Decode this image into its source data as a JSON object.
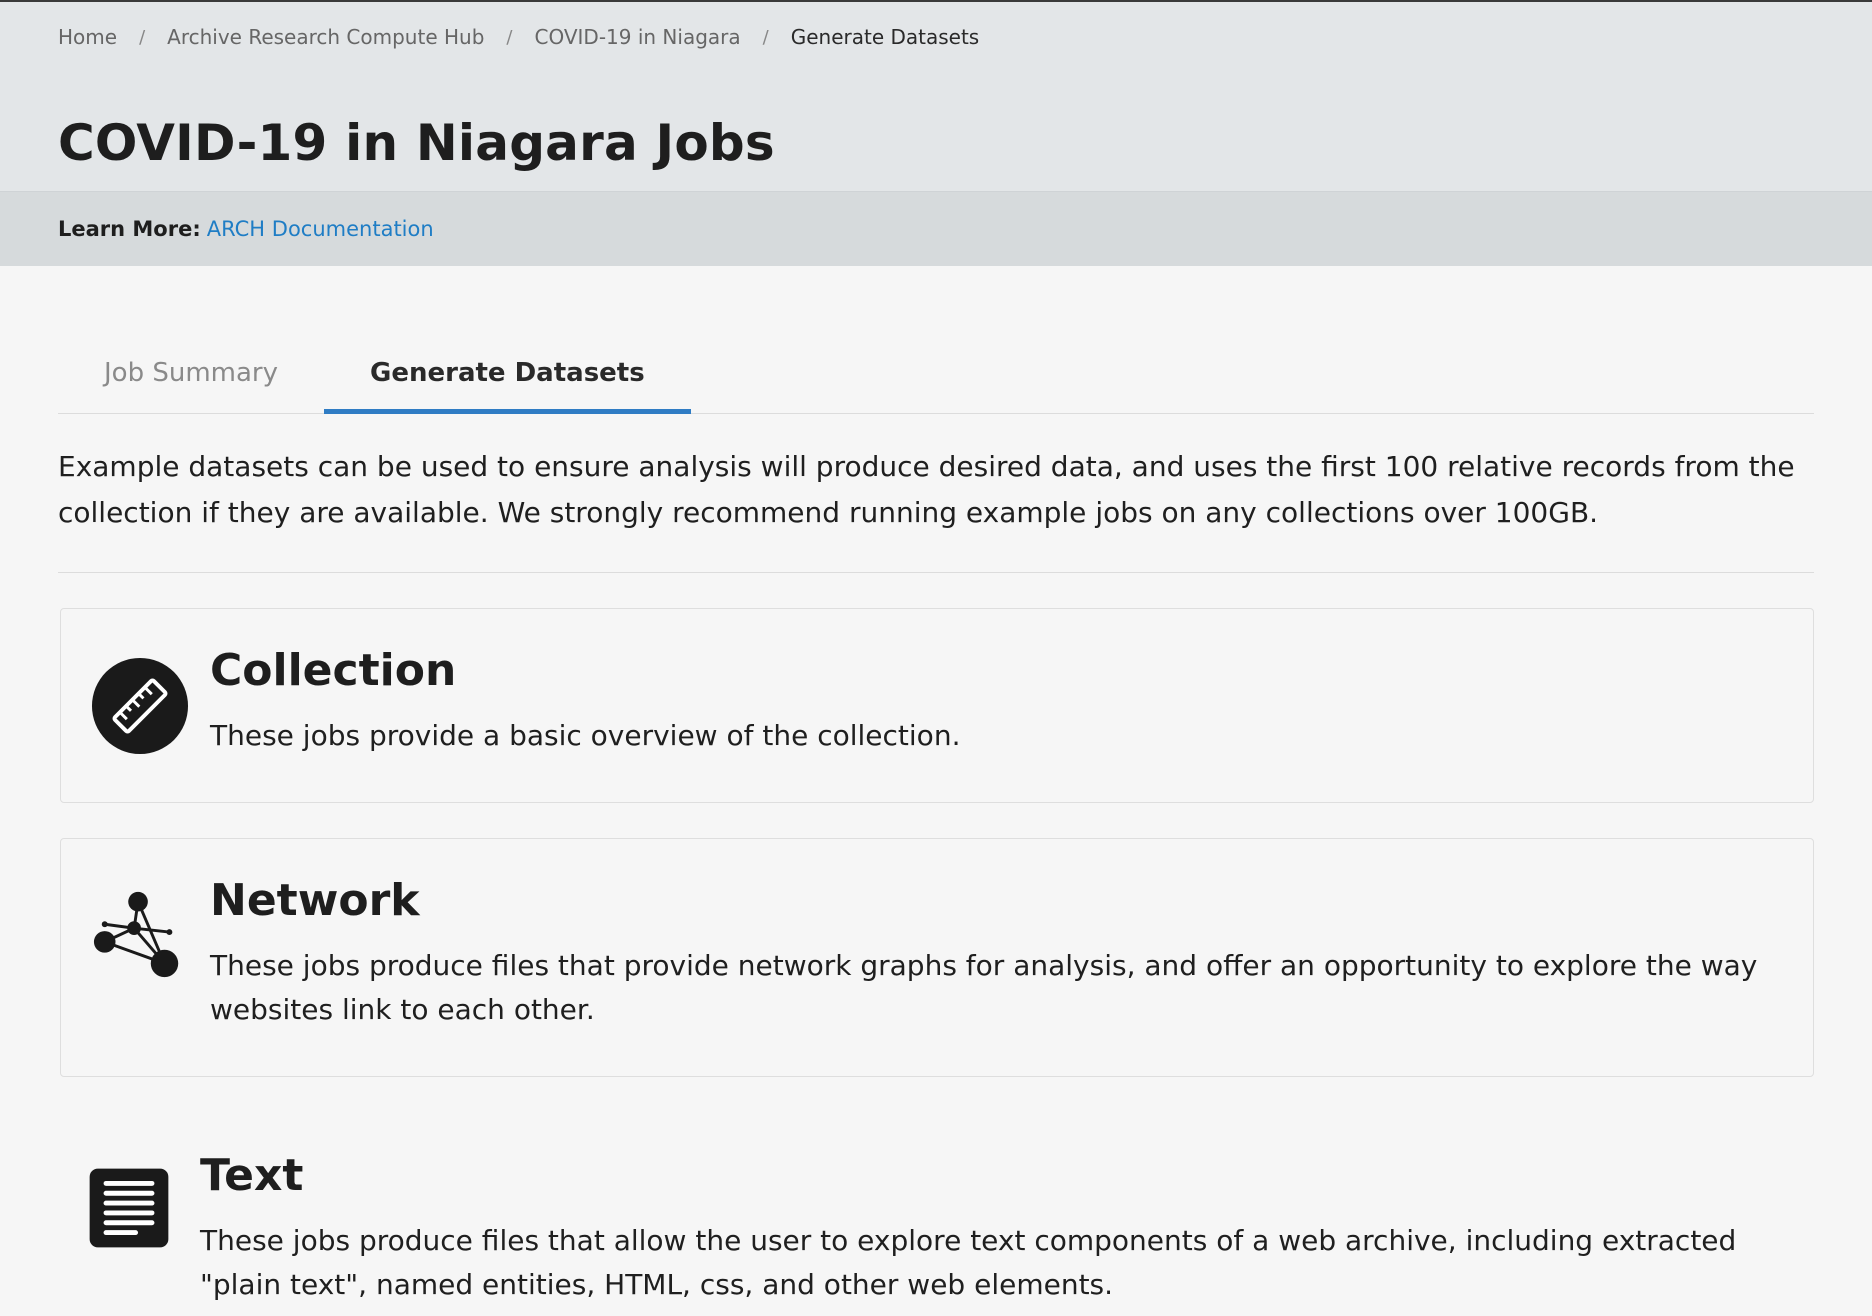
{
  "breadcrumb": [
    "Home",
    "Archive Research Compute Hub",
    "COVID-19 in Niagara",
    "Generate Datasets"
  ],
  "page_title": "COVID-19 in Niagara Jobs",
  "learn_more": {
    "label": "Learn More:",
    "link": "ARCH Documentation"
  },
  "tabs": [
    {
      "label": "Job Summary",
      "active": false
    },
    {
      "label": "Generate Datasets",
      "active": true
    }
  ],
  "intro": "Example datasets can be used to ensure analysis will produce desired data, and uses the first 100 relative records from the collection if they are available. We strongly recommend running example jobs on any collections over 100GB.",
  "categories": [
    {
      "icon": "ruler-icon",
      "title": "Collection",
      "description": "These jobs provide a basic overview of the collection."
    },
    {
      "icon": "network-icon",
      "title": "Network",
      "description": "These jobs produce files that provide network graphs for analysis, and offer an opportunity to explore the way websites link to each other."
    },
    {
      "icon": "document-icon",
      "title": "Text",
      "description": "These jobs produce files that allow the user to explore text components of a web archive, including extracted \"plain text\", named entities, HTML, css, and other web elements."
    }
  ],
  "colors": {
    "accent": "#2f7cc4",
    "link": "#1f7dc5",
    "header_bg": "#e3e6e8",
    "learn_bg": "#d6dadc"
  }
}
